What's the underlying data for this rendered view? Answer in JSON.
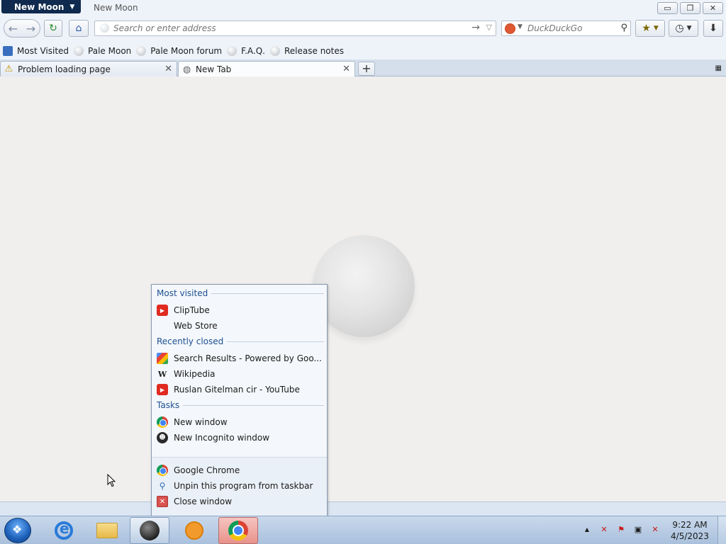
{
  "window": {
    "app_menu_label": "New Moon",
    "title": "New Moon",
    "controls": {
      "minimize": "▭",
      "restore": "❐",
      "close": "✕"
    }
  },
  "navbar": {
    "back_icon": "←",
    "forward_icon": "→",
    "reload_icon": "↻",
    "home_icon": "⌂",
    "url_placeholder": "Search or enter address",
    "go_icon": "→",
    "url_dropdown_icon": "▽",
    "search_engine": "DuckDuckGo",
    "search_placeholder": "DuckDuckGo",
    "search_icon": "⚲",
    "bookmark_menu_icon": "★",
    "history_icon": "◷",
    "download_icon": "⬇"
  },
  "bookmarks": [
    {
      "label": "Most Visited",
      "icon": "most-visited-icon"
    },
    {
      "label": "Pale Moon",
      "icon": "pale-moon-icon"
    },
    {
      "label": "Pale Moon forum",
      "icon": "pale-moon-icon"
    },
    {
      "label": "F.A.Q.",
      "icon": "pale-moon-icon"
    },
    {
      "label": "Release notes",
      "icon": "pale-moon-icon"
    }
  ],
  "tabs": [
    {
      "label": "Problem loading page",
      "icon": "⚠",
      "active": false,
      "close": "✕"
    },
    {
      "label": "New Tab",
      "icon": "◍",
      "active": true,
      "close": "✕"
    }
  ],
  "new_tab_label": "+",
  "tab_grid_icon": "▦",
  "jumplist": {
    "sections": {
      "most_visited": "Most visited",
      "recently_closed": "Recently closed",
      "tasks": "Tasks"
    },
    "most_visited": [
      {
        "label": "ClipTube",
        "icon": "▶"
      },
      {
        "label": "Web Store",
        "icon": ""
      }
    ],
    "recently_closed": [
      {
        "label": "Search Results - Powered by Goo...",
        "icon": ""
      },
      {
        "label": "Wikipedia",
        "icon": "W"
      },
      {
        "label": "Ruslan Gitelman cir - YouTube",
        "icon": "▶"
      }
    ],
    "tasks": [
      {
        "label": "New window",
        "icon": ""
      },
      {
        "label": "New Incognito window",
        "icon": "☻"
      }
    ],
    "program": [
      {
        "label": "Google Chrome",
        "icon": ""
      },
      {
        "label": "Unpin this program from taskbar",
        "icon": "⚲"
      },
      {
        "label": "Close window",
        "icon": "✕"
      }
    ]
  },
  "taskbar": {
    "tray_up_arrow": "▲",
    "tray_icons": [
      "✕",
      "⚑",
      "▣",
      "✕"
    ],
    "time": "9:22 AM",
    "date": "4/5/2023"
  }
}
